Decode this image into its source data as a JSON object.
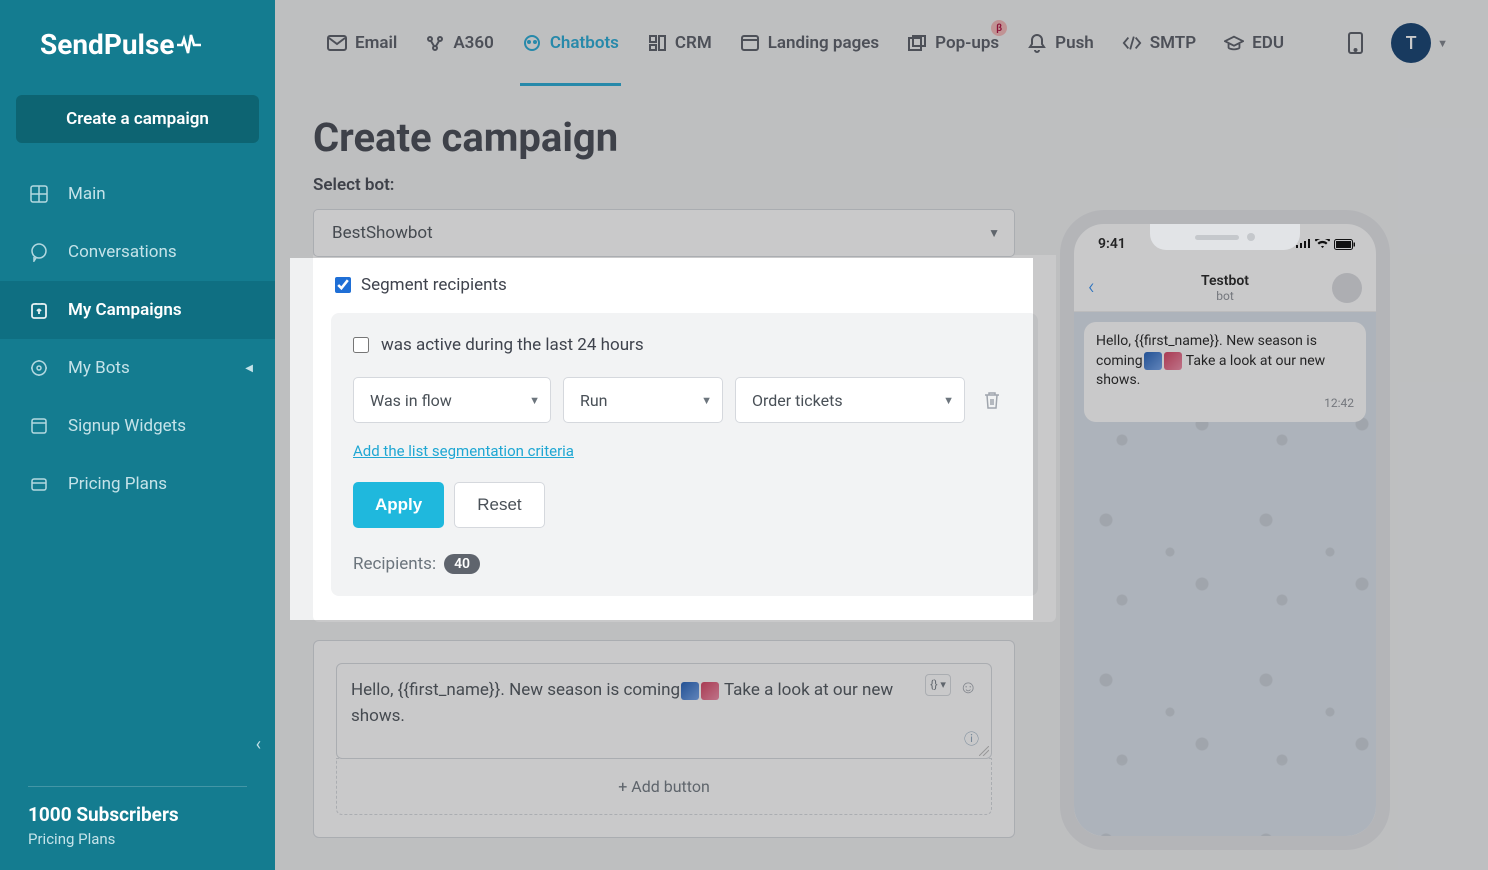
{
  "brand": "SendPulse",
  "sidebar": {
    "create_campaign": "Create a campaign",
    "items": [
      {
        "label": "Main"
      },
      {
        "label": "Conversations"
      },
      {
        "label": "My Campaigns"
      },
      {
        "label": "My Bots"
      },
      {
        "label": "Signup Widgets"
      },
      {
        "label": "Pricing Plans"
      }
    ],
    "footer": {
      "subscribers": "1000 Subscribers",
      "plan": "Pricing Plans"
    }
  },
  "topnav": {
    "items": [
      {
        "label": "Email"
      },
      {
        "label": "A360"
      },
      {
        "label": "Chatbots"
      },
      {
        "label": "CRM"
      },
      {
        "label": "Landing pages"
      },
      {
        "label": "Pop-ups",
        "badge": "β"
      },
      {
        "label": "Push"
      },
      {
        "label": "SMTP"
      },
      {
        "label": "EDU"
      }
    ],
    "avatar_initial": "T"
  },
  "page": {
    "title": "Create campaign",
    "select_bot_label": "Select bot:",
    "selected_bot": "BestShowbot",
    "segment": {
      "checkbox_label": "Segment recipients",
      "active24_label": "was active during the last 24 hours",
      "dd1": "Was in flow",
      "dd2": "Run",
      "dd3": "Order tickets",
      "add_criteria": "Add the list segmentation criteria",
      "apply": "Apply",
      "reset": "Reset",
      "recipients_label": "Recipients:",
      "recipients_count": "40"
    },
    "message": {
      "text_before": "Hello,  {{first_name}}. New season is coming",
      "text_after": " Take a look at our new shows.",
      "add_button": "+ Add button",
      "var_tool": "{} ▾"
    }
  },
  "preview": {
    "time": "9:41",
    "bot_name": "Testbot",
    "bot_sub": "bot",
    "msg_before": "Hello,  {{first_name}}. New season is coming",
    "msg_after": " Take a look at our new shows.",
    "msg_time": "12:42"
  }
}
